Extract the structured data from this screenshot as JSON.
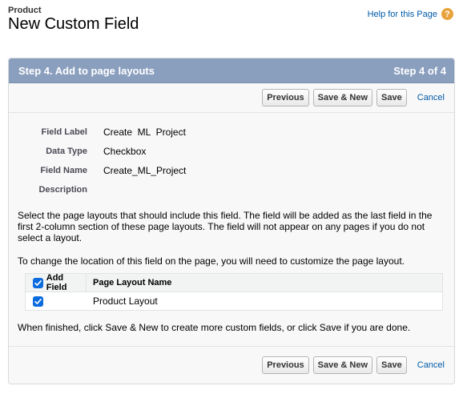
{
  "header": {
    "breadcrumb": "Product",
    "title": "New Custom Field",
    "help_link": "Help for this Page",
    "help_icon": "?"
  },
  "step": {
    "title": "Step 4. Add to page layouts",
    "progress": "Step 4 of 4"
  },
  "buttons": {
    "previous": "Previous",
    "save_new": "Save & New",
    "save": "Save",
    "cancel": "Cancel"
  },
  "fields": [
    {
      "label": "Field Label",
      "value": "Create  ML  Project"
    },
    {
      "label": "Data Type",
      "value": "Checkbox"
    },
    {
      "label": "Field Name",
      "value": "Create_ML_Project"
    },
    {
      "label": "Description",
      "value": ""
    }
  ],
  "instructions": {
    "select_layouts": "Select the page layouts that should include this field. The field will be added as the last field in the first 2-column section of these page layouts. The field will not appear on any pages if you do not select a layout.",
    "change_location": "To change the location of this field on the page, you will need to customize the page layout.",
    "finished": "When finished, click Save & New to create more custom fields, or click Save if you are done."
  },
  "layout_table": {
    "headers": {
      "add_field": "Add Field",
      "layout_name": "Page Layout Name"
    },
    "header_checked": true,
    "rows": [
      {
        "checked": true,
        "name": "Product Layout"
      }
    ]
  },
  "colors": {
    "header_bar": "#8a9ebe",
    "link": "#015ba7",
    "checkbox": "#0b6bdf",
    "help_icon": "#e8a33d"
  }
}
